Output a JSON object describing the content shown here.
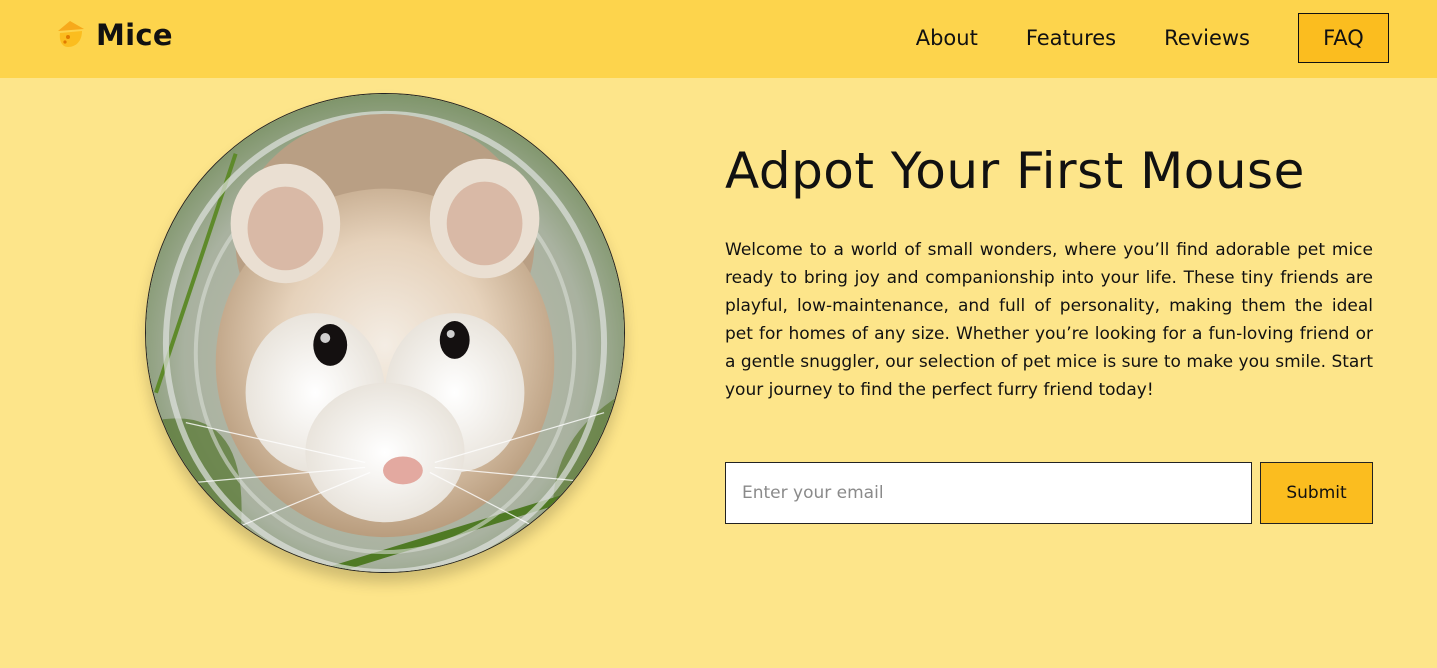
{
  "brand": {
    "name": "Mice",
    "icon": "mouse-logo-icon",
    "accent": "#f7a91b"
  },
  "nav": {
    "links": [
      "About",
      "Features",
      "Reviews"
    ],
    "faq_label": "FAQ"
  },
  "hero": {
    "image_icon": "hamster-photo",
    "title": "Adpot Your First Mouse",
    "description": "Welcome to a world of small wonders, where you’ll find adorable pet mice ready to bring joy and companionship into your life. These tiny friends are playful, low-maintenance, and full of personality, making them the ideal pet for homes of any size. Whether you’re looking for a fun-loving friend or a gentle snuggler, our selection of pet mice is sure to make you smile. Start your journey to find the perfect furry friend today!",
    "email_placeholder": "Enter your email",
    "email_value": "",
    "submit_label": "Submit"
  },
  "colors": {
    "page_bg": "#fde58a",
    "navbar_bg": "#fdd44c",
    "button_bg": "#fbbd1f"
  }
}
